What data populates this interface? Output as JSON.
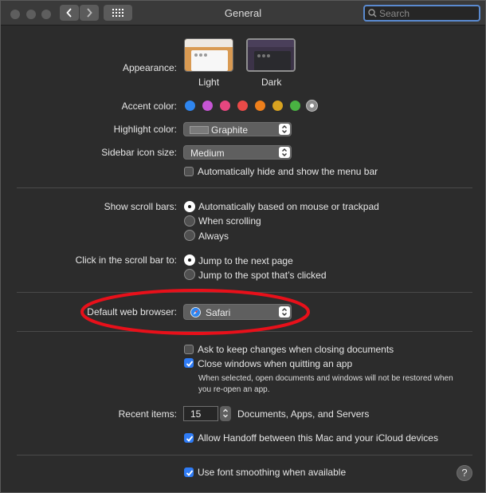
{
  "window": {
    "title": "General"
  },
  "search": {
    "placeholder": "Search"
  },
  "appearance": {
    "label": "Appearance:",
    "options": [
      {
        "label": "Light",
        "selected": false
      },
      {
        "label": "Dark",
        "selected": true
      }
    ]
  },
  "accent_color": {
    "label": "Accent color:",
    "swatches": [
      "#2f86ef",
      "#c655d4",
      "#e6467f",
      "#ea4a48",
      "#ee7f1b",
      "#d8a320",
      "#49b242",
      "#8c8c8c"
    ],
    "selected": "graphite"
  },
  "highlight_color": {
    "label": "Highlight color:",
    "value": "Graphite"
  },
  "sidebar_icon_size": {
    "label": "Sidebar icon size:",
    "value": "Medium"
  },
  "auto_hide_menu_bar": {
    "label": "Automatically hide and show the menu bar",
    "checked": false
  },
  "show_scroll_bars": {
    "label": "Show scroll bars:",
    "options": [
      {
        "label": "Automatically based on mouse or trackpad",
        "selected": true
      },
      {
        "label": "When scrolling",
        "selected": false
      },
      {
        "label": "Always",
        "selected": false
      }
    ]
  },
  "click_scroll_bar": {
    "label": "Click in the scroll bar to:",
    "options": [
      {
        "label": "Jump to the next page",
        "selected": true
      },
      {
        "label": "Jump to the spot that’s clicked",
        "selected": false
      }
    ]
  },
  "default_browser": {
    "label": "Default web browser:",
    "value": "Safari"
  },
  "ask_keep_changes": {
    "label": "Ask to keep changes when closing documents",
    "checked": false
  },
  "close_windows": {
    "label": "Close windows when quitting an app",
    "checked": true,
    "note": "When selected, open documents and windows will not be restored when you re-open an app."
  },
  "recent_items": {
    "label": "Recent items:",
    "value": "15",
    "suffix": "Documents, Apps, and Servers"
  },
  "handoff": {
    "label": "Allow Handoff between this Mac and your iCloud devices",
    "checked": true
  },
  "font_smoothing": {
    "label": "Use font smoothing when available",
    "checked": true
  },
  "help": {
    "glyph": "?"
  },
  "colors": {
    "annotation": "#e8101a",
    "accent": "#2f7cf6"
  }
}
